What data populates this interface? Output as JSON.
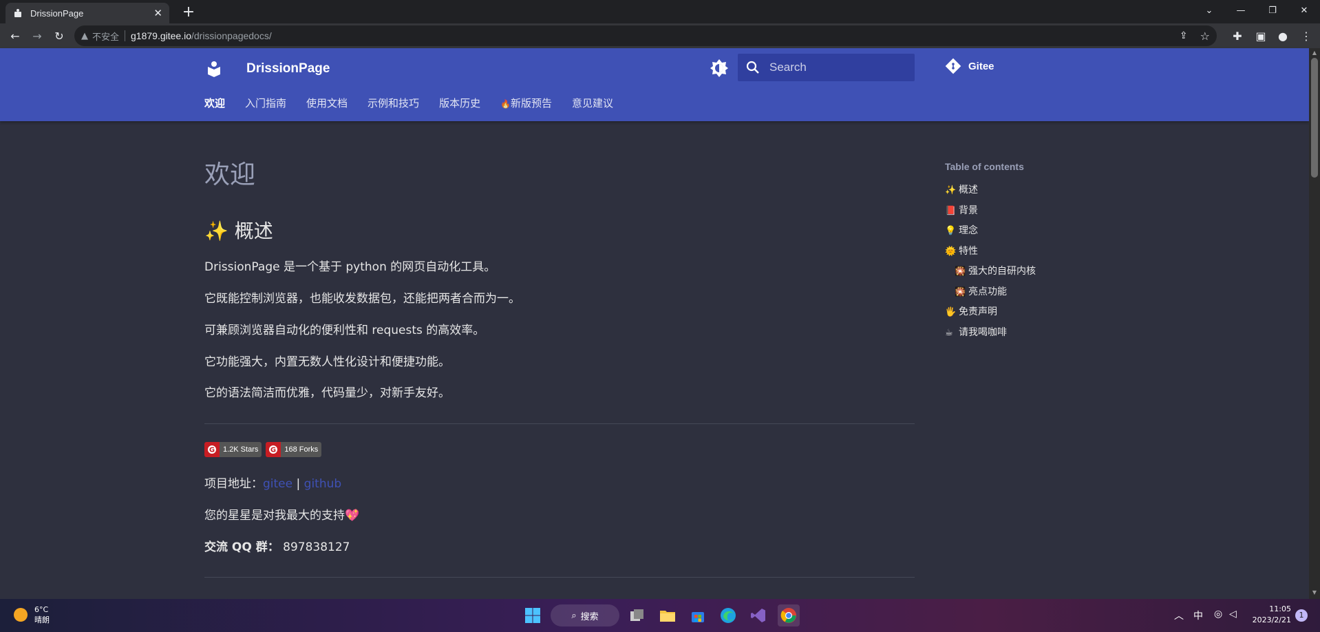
{
  "browser": {
    "tab_title": "DrissionPage",
    "tab_close": "✕",
    "new_tab": "+",
    "insecure_label": "不安全",
    "url_host": "g1879.gitee.io",
    "url_path": "/drissionpagedocs/"
  },
  "header": {
    "site_title": "DrissionPage",
    "search_placeholder": "Search",
    "repo_label": "Gitee",
    "nav": [
      "欢迎",
      "入门指南",
      "使用文档",
      "示例和技巧",
      "版本历史",
      "新版预告",
      "意见建议"
    ],
    "nav_fire_icon": "🔥"
  },
  "content": {
    "h1": "欢迎",
    "h2_emoji": "✨",
    "h2": "概述",
    "paragraphs": [
      "DrissionPage 是一个基于 python 的网页自动化工具。",
      "它既能控制浏览器，也能收发数据包，还能把两者合而为一。",
      "可兼顾浏览器自动化的便利性和 requests 的高效率。",
      "它功能强大，内置无数人性化设计和便捷功能。",
      "它的语法简洁而优雅，代码量少，对新手友好。"
    ],
    "badges": [
      {
        "text": "1.2K Stars"
      },
      {
        "text": "168 Forks"
      }
    ],
    "project_label": "项目地址：",
    "link_gitee": "gitee",
    "link_sep": " | ",
    "link_github": "github",
    "star_text": "您的星星是对我最大的支持💖",
    "qq_label": "交流 QQ 群：",
    "qq_number": "897838127"
  },
  "toc": {
    "title": "Table of contents",
    "items": [
      {
        "emoji": "✨",
        "label": "概述",
        "sub": false
      },
      {
        "emoji": "📕",
        "label": "背景",
        "sub": false
      },
      {
        "emoji": "💡",
        "label": "理念",
        "sub": false
      },
      {
        "emoji": "🌞",
        "label": "特性",
        "sub": false
      },
      {
        "emoji": "🎇",
        "label": "强大的自研内核",
        "sub": true
      },
      {
        "emoji": "🎇",
        "label": "亮点功能",
        "sub": true
      },
      {
        "emoji": "🖐",
        "label": "免责声明",
        "sub": false
      },
      {
        "emoji": "☕",
        "label": "请我喝咖啡",
        "sub": false
      }
    ]
  },
  "taskbar": {
    "temperature": "6°C",
    "weather": "晴朗",
    "search_label": "搜索",
    "ime": "中",
    "time": "11:05",
    "date": "2023/2/21",
    "notifications": "1"
  },
  "colors": {
    "header_bg": "#3f51b5",
    "search_bg": "#303f9f",
    "page_bg": "#2e303e",
    "link": "#3f51b5"
  }
}
